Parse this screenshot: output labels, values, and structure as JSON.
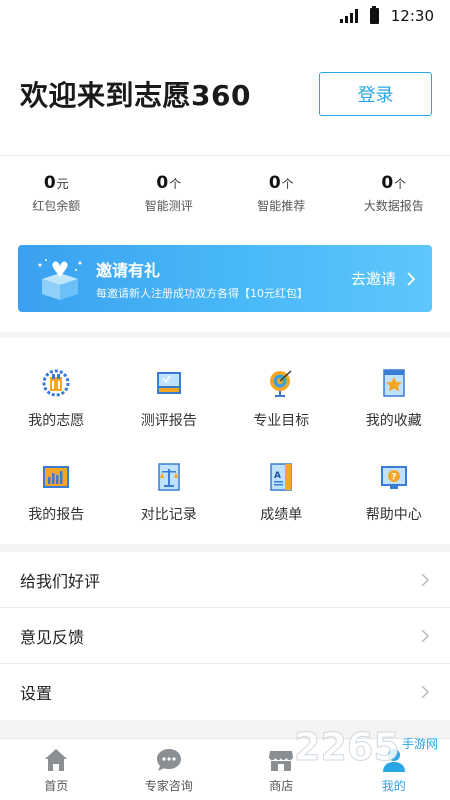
{
  "status_bar": {
    "time": "12:30"
  },
  "header": {
    "title": "欢迎来到志愿360",
    "login_label": "登录"
  },
  "stats": [
    {
      "value": "0",
      "unit": "元",
      "label": "红包余额"
    },
    {
      "value": "0",
      "unit": "个",
      "label": "智能测评"
    },
    {
      "value": "0",
      "unit": "个",
      "label": "智能推荐"
    },
    {
      "value": "0",
      "unit": "个",
      "label": "大数据报告"
    }
  ],
  "banner": {
    "title": "邀请有礼",
    "subtitle": "每邀请新人注册成功双方各得【10元红包】",
    "action": "去邀请"
  },
  "grid": [
    {
      "label": "我的志愿",
      "icon": "my-volunteer-icon"
    },
    {
      "label": "测评报告",
      "icon": "assessment-report-icon"
    },
    {
      "label": "专业目标",
      "icon": "major-target-icon"
    },
    {
      "label": "我的收藏",
      "icon": "favorites-icon"
    },
    {
      "label": "我的报告",
      "icon": "my-report-icon"
    },
    {
      "label": "对比记录",
      "icon": "compare-record-icon"
    },
    {
      "label": "成绩单",
      "icon": "transcript-icon"
    },
    {
      "label": "帮助中心",
      "icon": "help-center-icon"
    }
  ],
  "list": [
    {
      "label": "给我们好评"
    },
    {
      "label": "意见反馈"
    },
    {
      "label": "设置"
    }
  ],
  "tabs": [
    {
      "label": "首页",
      "icon": "home-icon"
    },
    {
      "label": "专家咨询",
      "icon": "chat-icon"
    },
    {
      "label": "商店",
      "icon": "store-icon"
    },
    {
      "label": "我的",
      "icon": "user-icon",
      "active": true
    }
  ],
  "watermark": {
    "text": "2265",
    "sub": "手游网"
  },
  "colors": {
    "accent": "#2aa6e6",
    "banner_start": "#3aa1f0",
    "banner_end": "#5ec6fb",
    "icon_gray": "#8a8f94"
  }
}
